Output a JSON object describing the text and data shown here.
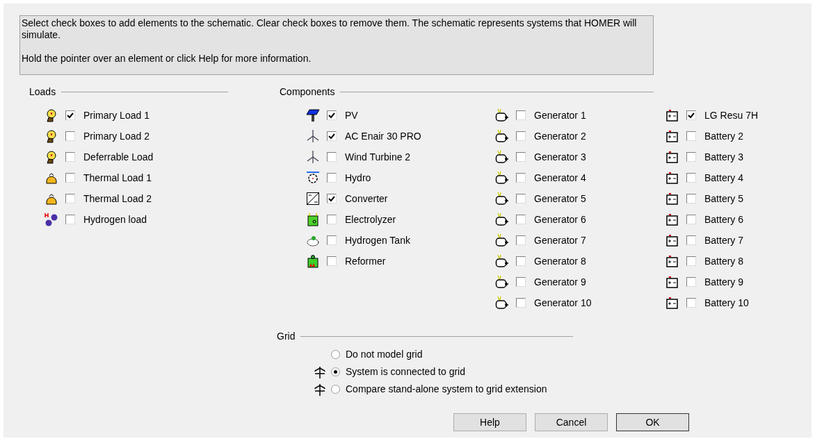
{
  "info": {
    "lines": [
      "Select check boxes to add elements to the schematic. Clear check boxes to remove them. The schematic represents systems that HOMER will simulate.",
      "Hold the pointer over an element or click Help for more information."
    ]
  },
  "loads": {
    "title": "Loads",
    "items": [
      {
        "label": "Primary Load 1",
        "kind": "bulb",
        "checked": true
      },
      {
        "label": "Primary Load 2",
        "kind": "bulb",
        "checked": false
      },
      {
        "label": "Deferrable Load",
        "kind": "bulb",
        "checked": false
      },
      {
        "label": "Thermal Load 1",
        "kind": "kettle",
        "checked": false
      },
      {
        "label": "Thermal Load 2",
        "kind": "kettle",
        "checked": false
      },
      {
        "label": "Hydrogen load",
        "kind": "hydrogen",
        "checked": false
      }
    ]
  },
  "components": {
    "title": "Components",
    "columns": [
      [
        {
          "label": "PV",
          "kind": "solar",
          "checked": true
        },
        {
          "label": "AC Enair 30 PRO",
          "kind": "turbine",
          "checked": true
        },
        {
          "label": "Wind Turbine 2",
          "kind": "turbine",
          "checked": false
        },
        {
          "label": "Hydro",
          "kind": "wheel",
          "checked": false
        },
        {
          "label": "Converter",
          "kind": "converter",
          "checked": true
        },
        {
          "label": "Electrolyzer",
          "kind": "electrolyzer",
          "checked": false
        },
        {
          "label": "Hydrogen Tank",
          "kind": "tank",
          "checked": false
        },
        {
          "label": "Reformer",
          "kind": "reformer",
          "checked": false
        }
      ],
      [
        {
          "label": "Generator 1",
          "kind": "generator",
          "checked": false
        },
        {
          "label": "Generator 2",
          "kind": "generator",
          "checked": false
        },
        {
          "label": "Generator 3",
          "kind": "generator",
          "checked": false
        },
        {
          "label": "Generator 4",
          "kind": "generator",
          "checked": false
        },
        {
          "label": "Generator 5",
          "kind": "generator",
          "checked": false
        },
        {
          "label": "Generator 6",
          "kind": "generator",
          "checked": false
        },
        {
          "label": "Generator 7",
          "kind": "generator",
          "checked": false
        },
        {
          "label": "Generator 8",
          "kind": "generator",
          "checked": false
        },
        {
          "label": "Generator 9",
          "kind": "generator",
          "checked": false
        },
        {
          "label": "Generator 10",
          "kind": "generator",
          "checked": false
        }
      ],
      [
        {
          "label": "LG Resu 7H",
          "kind": "battery",
          "checked": true
        },
        {
          "label": "Battery 2",
          "kind": "battery",
          "checked": false
        },
        {
          "label": "Battery 3",
          "kind": "battery",
          "checked": false
        },
        {
          "label": "Battery 4",
          "kind": "battery",
          "checked": false
        },
        {
          "label": "Battery 5",
          "kind": "battery",
          "checked": false
        },
        {
          "label": "Battery 6",
          "kind": "battery",
          "checked": false
        },
        {
          "label": "Battery 7",
          "kind": "battery",
          "checked": false
        },
        {
          "label": "Battery 8",
          "kind": "battery",
          "checked": false
        },
        {
          "label": "Battery 9",
          "kind": "battery",
          "checked": false
        },
        {
          "label": "Battery 10",
          "kind": "battery",
          "checked": false
        }
      ]
    ]
  },
  "grid": {
    "title": "Grid",
    "options": [
      {
        "label": "Do not model grid",
        "kind": "plain",
        "selected": false
      },
      {
        "label": "System is connected to grid",
        "kind": "tower",
        "selected": true
      },
      {
        "label": "Compare stand-alone system to grid extension",
        "kind": "tower",
        "selected": false
      }
    ]
  },
  "buttons": [
    "Help",
    "Cancel",
    "OK"
  ]
}
